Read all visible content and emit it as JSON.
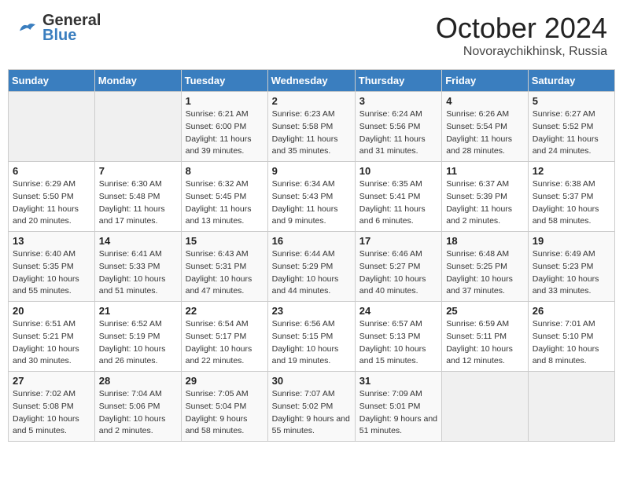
{
  "header": {
    "logo_line1": "General",
    "logo_line2": "Blue",
    "month_title": "October 2024",
    "location": "Novoraychikhinsk, Russia"
  },
  "weekdays": [
    "Sunday",
    "Monday",
    "Tuesday",
    "Wednesday",
    "Thursday",
    "Friday",
    "Saturday"
  ],
  "weeks": [
    [
      {
        "day": "",
        "info": ""
      },
      {
        "day": "",
        "info": ""
      },
      {
        "day": "1",
        "info": "Sunrise: 6:21 AM\nSunset: 6:00 PM\nDaylight: 11 hours and 39 minutes."
      },
      {
        "day": "2",
        "info": "Sunrise: 6:23 AM\nSunset: 5:58 PM\nDaylight: 11 hours and 35 minutes."
      },
      {
        "day": "3",
        "info": "Sunrise: 6:24 AM\nSunset: 5:56 PM\nDaylight: 11 hours and 31 minutes."
      },
      {
        "day": "4",
        "info": "Sunrise: 6:26 AM\nSunset: 5:54 PM\nDaylight: 11 hours and 28 minutes."
      },
      {
        "day": "5",
        "info": "Sunrise: 6:27 AM\nSunset: 5:52 PM\nDaylight: 11 hours and 24 minutes."
      }
    ],
    [
      {
        "day": "6",
        "info": "Sunrise: 6:29 AM\nSunset: 5:50 PM\nDaylight: 11 hours and 20 minutes."
      },
      {
        "day": "7",
        "info": "Sunrise: 6:30 AM\nSunset: 5:48 PM\nDaylight: 11 hours and 17 minutes."
      },
      {
        "day": "8",
        "info": "Sunrise: 6:32 AM\nSunset: 5:45 PM\nDaylight: 11 hours and 13 minutes."
      },
      {
        "day": "9",
        "info": "Sunrise: 6:34 AM\nSunset: 5:43 PM\nDaylight: 11 hours and 9 minutes."
      },
      {
        "day": "10",
        "info": "Sunrise: 6:35 AM\nSunset: 5:41 PM\nDaylight: 11 hours and 6 minutes."
      },
      {
        "day": "11",
        "info": "Sunrise: 6:37 AM\nSunset: 5:39 PM\nDaylight: 11 hours and 2 minutes."
      },
      {
        "day": "12",
        "info": "Sunrise: 6:38 AM\nSunset: 5:37 PM\nDaylight: 10 hours and 58 minutes."
      }
    ],
    [
      {
        "day": "13",
        "info": "Sunrise: 6:40 AM\nSunset: 5:35 PM\nDaylight: 10 hours and 55 minutes."
      },
      {
        "day": "14",
        "info": "Sunrise: 6:41 AM\nSunset: 5:33 PM\nDaylight: 10 hours and 51 minutes."
      },
      {
        "day": "15",
        "info": "Sunrise: 6:43 AM\nSunset: 5:31 PM\nDaylight: 10 hours and 47 minutes."
      },
      {
        "day": "16",
        "info": "Sunrise: 6:44 AM\nSunset: 5:29 PM\nDaylight: 10 hours and 44 minutes."
      },
      {
        "day": "17",
        "info": "Sunrise: 6:46 AM\nSunset: 5:27 PM\nDaylight: 10 hours and 40 minutes."
      },
      {
        "day": "18",
        "info": "Sunrise: 6:48 AM\nSunset: 5:25 PM\nDaylight: 10 hours and 37 minutes."
      },
      {
        "day": "19",
        "info": "Sunrise: 6:49 AM\nSunset: 5:23 PM\nDaylight: 10 hours and 33 minutes."
      }
    ],
    [
      {
        "day": "20",
        "info": "Sunrise: 6:51 AM\nSunset: 5:21 PM\nDaylight: 10 hours and 30 minutes."
      },
      {
        "day": "21",
        "info": "Sunrise: 6:52 AM\nSunset: 5:19 PM\nDaylight: 10 hours and 26 minutes."
      },
      {
        "day": "22",
        "info": "Sunrise: 6:54 AM\nSunset: 5:17 PM\nDaylight: 10 hours and 22 minutes."
      },
      {
        "day": "23",
        "info": "Sunrise: 6:56 AM\nSunset: 5:15 PM\nDaylight: 10 hours and 19 minutes."
      },
      {
        "day": "24",
        "info": "Sunrise: 6:57 AM\nSunset: 5:13 PM\nDaylight: 10 hours and 15 minutes."
      },
      {
        "day": "25",
        "info": "Sunrise: 6:59 AM\nSunset: 5:11 PM\nDaylight: 10 hours and 12 minutes."
      },
      {
        "day": "26",
        "info": "Sunrise: 7:01 AM\nSunset: 5:10 PM\nDaylight: 10 hours and 8 minutes."
      }
    ],
    [
      {
        "day": "27",
        "info": "Sunrise: 7:02 AM\nSunset: 5:08 PM\nDaylight: 10 hours and 5 minutes."
      },
      {
        "day": "28",
        "info": "Sunrise: 7:04 AM\nSunset: 5:06 PM\nDaylight: 10 hours and 2 minutes."
      },
      {
        "day": "29",
        "info": "Sunrise: 7:05 AM\nSunset: 5:04 PM\nDaylight: 9 hours and 58 minutes."
      },
      {
        "day": "30",
        "info": "Sunrise: 7:07 AM\nSunset: 5:02 PM\nDaylight: 9 hours and 55 minutes."
      },
      {
        "day": "31",
        "info": "Sunrise: 7:09 AM\nSunset: 5:01 PM\nDaylight: 9 hours and 51 minutes."
      },
      {
        "day": "",
        "info": ""
      },
      {
        "day": "",
        "info": ""
      }
    ]
  ]
}
